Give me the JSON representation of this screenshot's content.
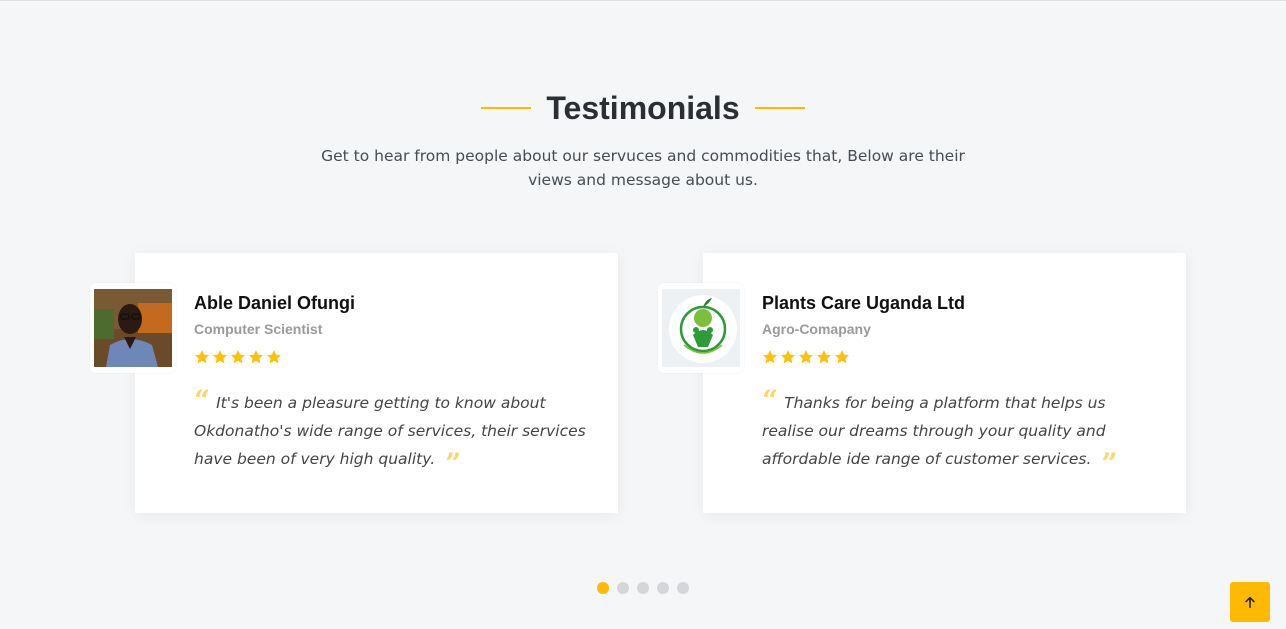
{
  "section": {
    "title": "Testimonials",
    "subtitle": "Get to hear from people about our servuces and commodities that, Below are their views and message about us."
  },
  "testimonials": [
    {
      "name": "Able Daniel Ofungi",
      "role": "Computer Scientist",
      "rating": 5,
      "quote": "It's been a pleasure getting to know about Okdonatho's wide range of services, their services have been of very high quality.",
      "avatar_icon": "person-photo-icon"
    },
    {
      "name": "Plants Care Uganda Ltd",
      "role": "Agro-Comapany",
      "rating": 5,
      "quote": "Thanks for being a platform that helps us realise our dreams through your quality and affordable ide range of customer services.",
      "avatar_icon": "plants-care-logo-icon"
    }
  ],
  "pagination": {
    "total": 5,
    "active": 1
  },
  "colors": {
    "accent": "#ffb900",
    "quote_mark": "#ffd565",
    "background": "#f4f6f8"
  },
  "back_to_top_icon": "arrow-up-icon"
}
